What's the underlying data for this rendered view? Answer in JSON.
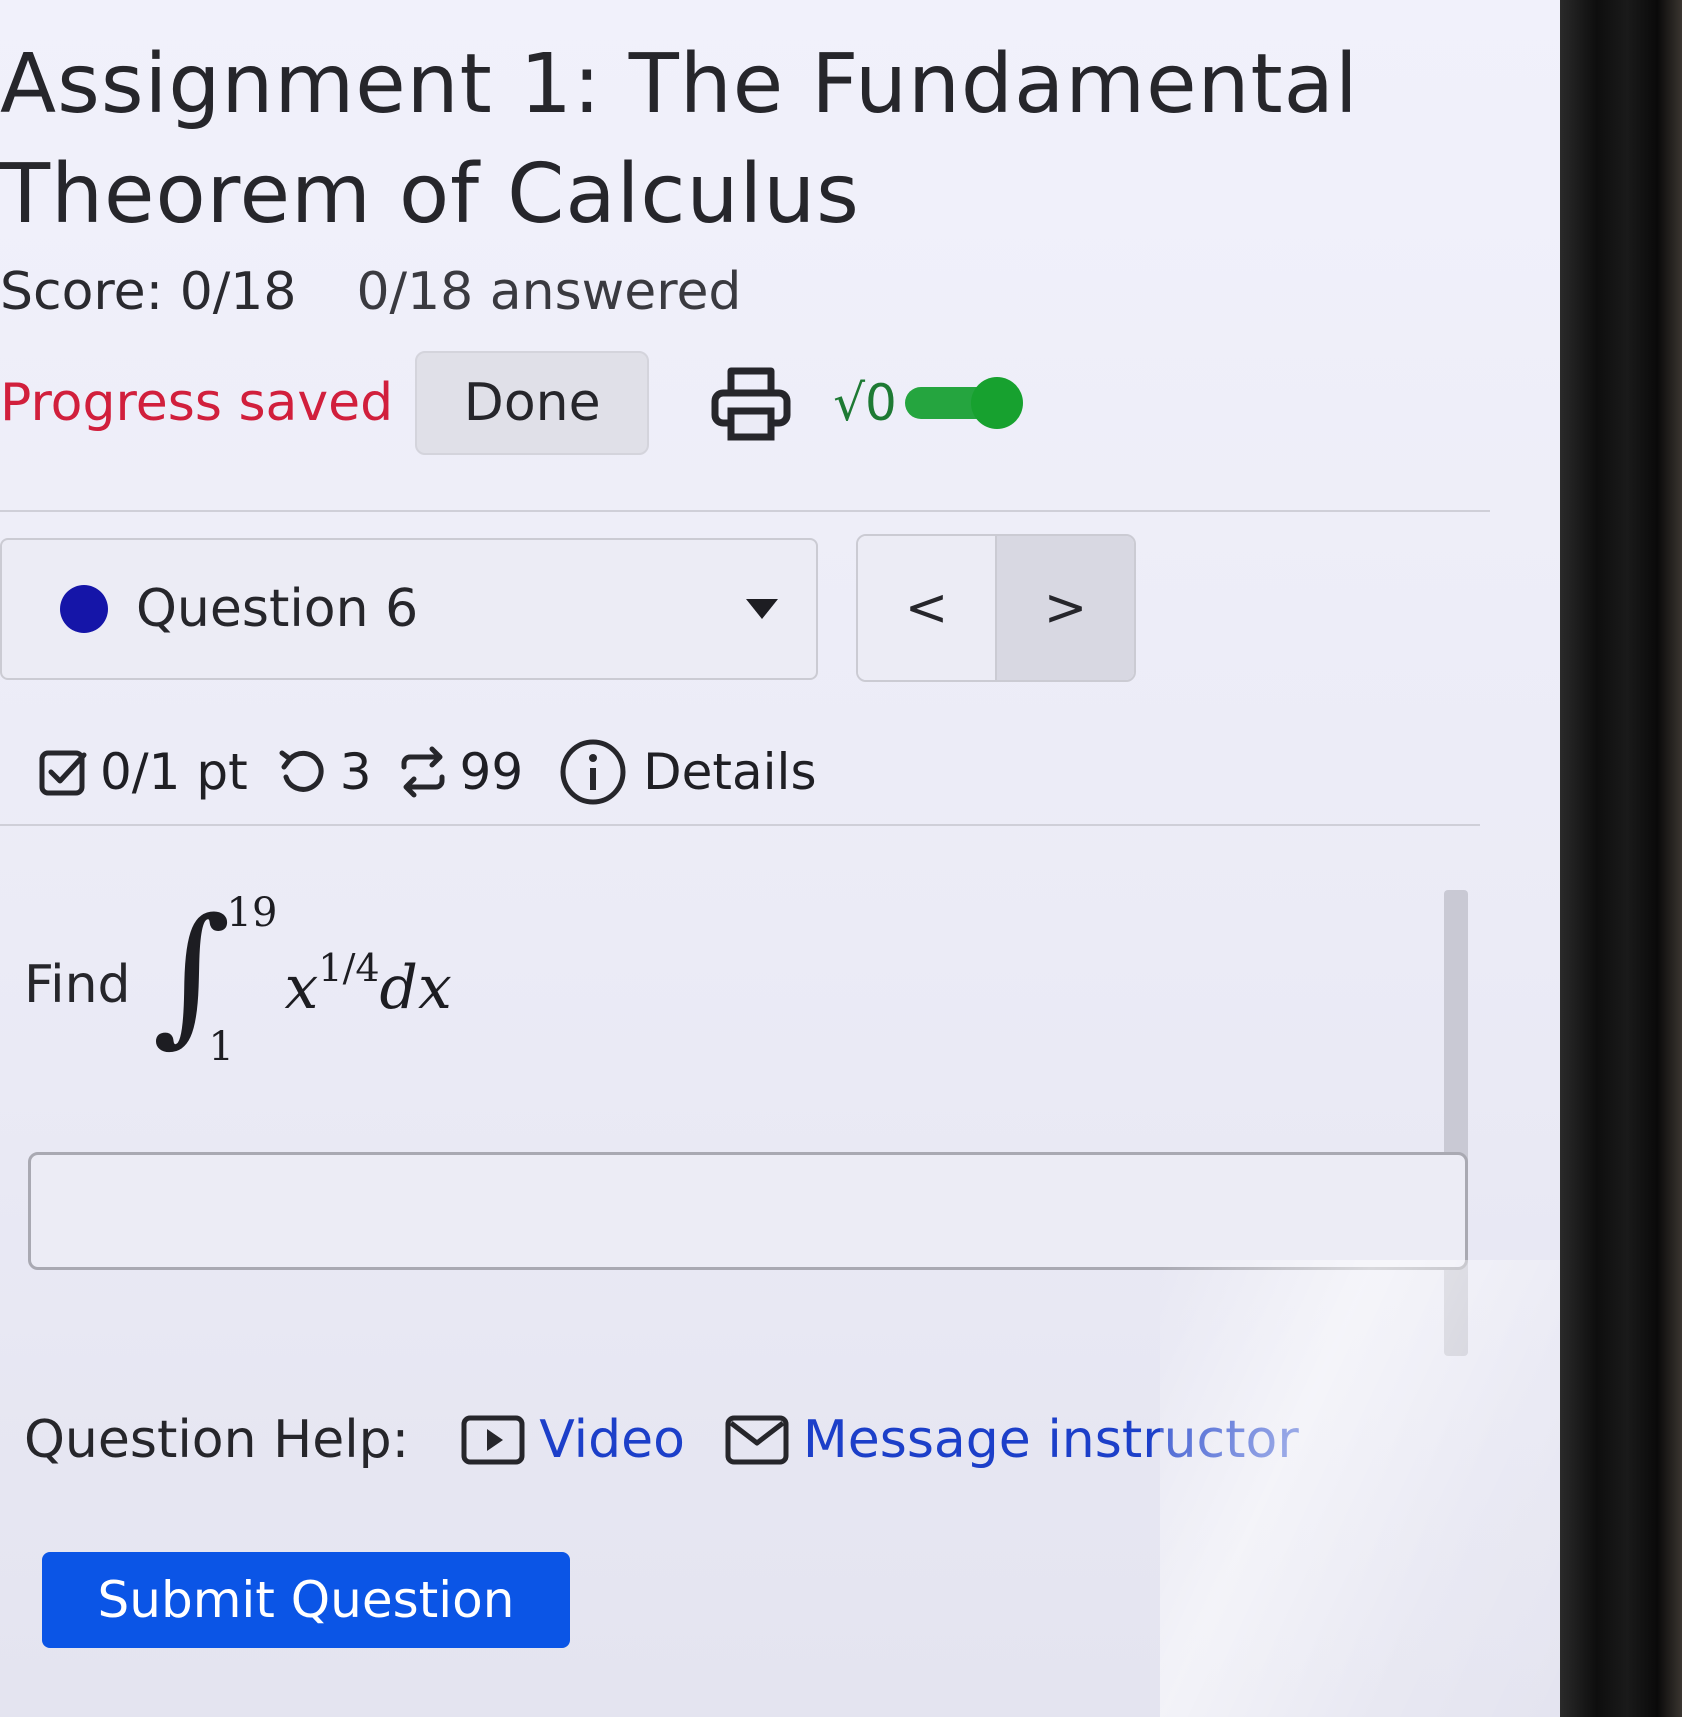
{
  "assignment": {
    "title": "Assignment 1: The Fundamental Theorem of Calculus",
    "score": "Score: 0/18",
    "answered": "0/18 answered"
  },
  "toolbar": {
    "progress_status": "Progress saved",
    "done_label": "Done",
    "print_icon": "printer-icon",
    "math_entry_label": "√0",
    "math_entry_toggle_on": true,
    "accent_color": "#17a12f"
  },
  "question_nav": {
    "selected": "Question 6",
    "status_color": "#1515a8",
    "prev_label": "<",
    "next_label": ">"
  },
  "question_meta": {
    "points": "0/1 pt",
    "retries": "3",
    "versions": "99",
    "details_label": "Details"
  },
  "problem": {
    "prompt": "Find",
    "upper_limit": "19",
    "lower_limit": "1",
    "integrand_base": "x",
    "integrand_exponent": "1/4",
    "differential": "dx",
    "answer_value": ""
  },
  "help": {
    "label": "Question Help:",
    "video_label": "Video",
    "message_label": "Message instructor",
    "link_color": "#1c3fc9"
  },
  "submit": {
    "label": "Submit Question",
    "color": "#0b55e6"
  }
}
